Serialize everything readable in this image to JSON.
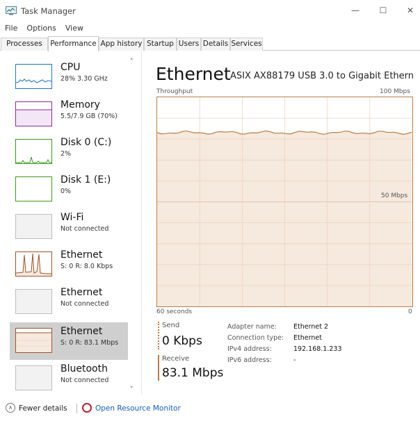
{
  "window": {
    "title": "Task Manager",
    "minimize_glyph": "—",
    "maximize_glyph": "☐",
    "close_glyph": "✕"
  },
  "menu": [
    "File",
    "Options",
    "View"
  ],
  "tabs": [
    "Processes",
    "Performance",
    "App history",
    "Startup",
    "Users",
    "Details",
    "Services"
  ],
  "active_tab": "Performance",
  "sidebar": {
    "items": [
      {
        "title": "CPU",
        "subtitle": "28% 3.30 GHz",
        "graph_color": "#1a73c9"
      },
      {
        "title": "Memory",
        "subtitle": "5.5/7.9 GB (70%)",
        "graph_color": "#8b2a9e"
      },
      {
        "title": "Disk 0 (C:)",
        "subtitle": "2%",
        "graph_color": "#3c9a1c"
      },
      {
        "title": "Disk 1 (E:)",
        "subtitle": "0%",
        "graph_color": "#3c9a1c"
      },
      {
        "title": "Wi-Fi",
        "subtitle": "Not connected",
        "graph_color": "#999999"
      },
      {
        "title": "Ethernet",
        "subtitle": "S: 0 R: 8.0 Kbps",
        "graph_color": "#a0522d"
      },
      {
        "title": "Ethernet",
        "subtitle": "Not connected",
        "graph_color": "#999999"
      },
      {
        "title": "Ethernet",
        "subtitle": "S: 0 R: 83.1 Mbps",
        "graph_color": "#a0522d",
        "selected": true
      },
      {
        "title": "Bluetooth",
        "subtitle": "Not connected",
        "graph_color": "#999999"
      }
    ],
    "scroll_up_icon": "˄",
    "scroll_down_icon": "˅"
  },
  "main": {
    "title": "Ethernet",
    "adapter": "ASIX AX88179 USB 3.0 to Gigabit Ethern...",
    "graph_label": "Throughput",
    "graph_max": "100 Mbps",
    "graph_mid": "50 Mbps",
    "time_left": "60 seconds",
    "time_right": "0",
    "graph_color": "#b97d45",
    "graph_fill": "#f6e9de",
    "receive_level_fraction": 0.831
  },
  "stats": {
    "send_label": "Send",
    "send_value": "0 Kbps",
    "receive_label": "Receive",
    "receive_value": "83.1 Mbps"
  },
  "info": {
    "adapter_name_label": "Adapter name:",
    "adapter_name": "Ethernet 2",
    "connection_type_label": "Connection type:",
    "connection_type": "Ethernet",
    "ipv4_label": "IPv4 address:",
    "ipv4": "192.168.1.233",
    "ipv6_label": "IPv6 address:",
    "ipv6": "-"
  },
  "footer": {
    "fewer_details": "Fewer details",
    "resource_monitor": "Open Resource Monitor"
  }
}
